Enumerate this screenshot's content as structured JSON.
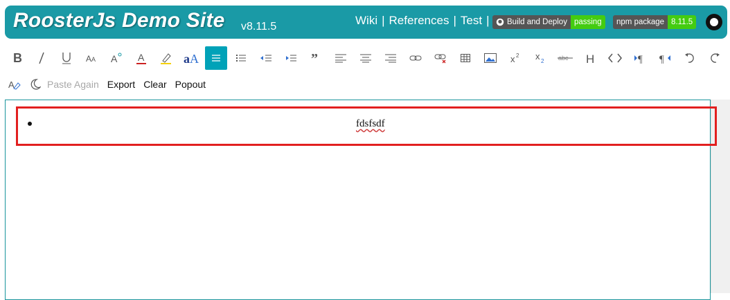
{
  "header": {
    "title": "RoosterJs Demo Site",
    "version": "v8.11.5",
    "nav": {
      "wiki": "Wiki",
      "references": "References",
      "test": "Test",
      "sep": "|"
    },
    "badge_build": {
      "label": "Build and Deploy",
      "status": "passing",
      "status_color": "#4c1"
    },
    "badge_npm": {
      "label": "npm package",
      "value": "8.11.5",
      "value_color": "#4c1"
    }
  },
  "toolbar": {
    "icons": [
      "bold-icon",
      "italic-icon",
      "underline-icon",
      "font-size-icon",
      "increase-font-icon",
      "font-color-icon",
      "highlight-icon",
      "font-family-icon",
      "bullet-list-icon",
      "numbered-list-icon",
      "outdent-icon",
      "indent-icon",
      "quote-icon",
      "align-left-icon",
      "align-center-icon",
      "align-right-icon",
      "link-icon",
      "unlink-icon",
      "table-icon",
      "image-icon",
      "superscript-icon",
      "subscript-icon",
      "strikethrough-icon",
      "header-icon",
      "code-icon",
      "ltr-icon",
      "rtl-icon",
      "undo-icon",
      "redo-icon"
    ],
    "row2": {
      "paste_again": "Paste Again",
      "export": "Export",
      "clear": "Clear",
      "popout": "Popout"
    }
  },
  "editor": {
    "list_item": "fdsfsdf"
  },
  "colors": {
    "accent": "#1a9aa6",
    "active_button": "#00a2b8",
    "highlight_box": "#e21f1f"
  }
}
